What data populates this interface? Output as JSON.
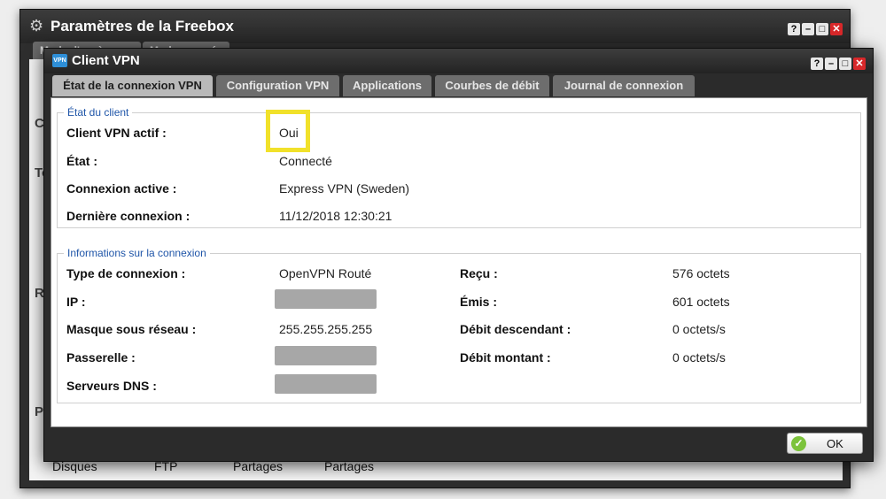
{
  "background_window": {
    "title": "Paramètres de la Freebox",
    "tabs": [
      "Mode d'accès",
      "Mode avancé"
    ],
    "side_letters": [
      "C",
      "To",
      "R",
      "P"
    ],
    "bottom_items": [
      "Disques",
      "FTP",
      "Partages",
      "Partages"
    ]
  },
  "dialog": {
    "title": "Client VPN",
    "logo_text": "VPN",
    "window_controls": [
      "?",
      "–",
      "□",
      "✕"
    ],
    "tabs": [
      "État de la connexion VPN",
      "Configuration VPN",
      "Applications",
      "Courbes de débit",
      "Journal de connexion"
    ],
    "active_tab": "État de la connexion VPN"
  },
  "client_state": {
    "legend": "État du client",
    "rows": [
      {
        "label": "Client VPN actif :",
        "value": "Oui"
      },
      {
        "label": "État :",
        "value": "Connecté"
      },
      {
        "label": "Connexion active :",
        "value": "Express VPN (Sweden)"
      },
      {
        "label": "Dernière connexion :",
        "value": "11/12/2018 12:30:21"
      }
    ]
  },
  "connection_info": {
    "legend": "Informations sur la connexion",
    "left": [
      {
        "label": "Type de connexion :",
        "value": "OpenVPN Routé"
      },
      {
        "label": "IP :",
        "value": ""
      },
      {
        "label": "Masque sous réseau :",
        "value": "255.255.255.255"
      },
      {
        "label": "Passerelle :",
        "value": ""
      },
      {
        "label": "Serveurs DNS :",
        "value": ""
      }
    ],
    "right": [
      {
        "label": "Reçu :",
        "value": "576 octets"
      },
      {
        "label": "Émis :",
        "value": "601 octets"
      },
      {
        "label": "Débit descendant :",
        "value": "0 octets/s"
      },
      {
        "label": "Débit montant :",
        "value": "0 octets/s"
      }
    ]
  },
  "footer": {
    "ok_label": "OK"
  },
  "colors": {
    "highlight": "#f1e12a",
    "legend": "#1f55a8",
    "close": "#d8282a",
    "ok_icon": "#7cc33b"
  }
}
